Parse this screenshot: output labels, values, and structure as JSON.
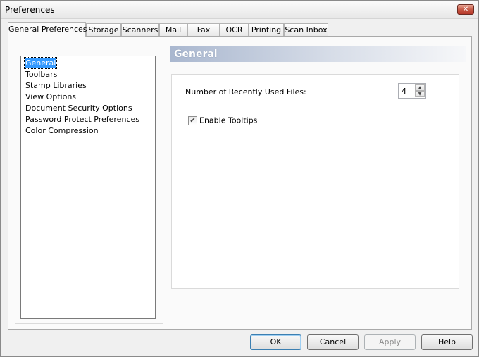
{
  "window": {
    "title": "Preferences",
    "close_glyph": "✕"
  },
  "tabs": [
    {
      "label": "General Preferences",
      "active": true
    },
    {
      "label": "Storage"
    },
    {
      "label": "Scanners"
    },
    {
      "label": "Mail"
    },
    {
      "label": "Fax"
    },
    {
      "label": "OCR"
    },
    {
      "label": "Printing"
    },
    {
      "label": "Scan Inbox"
    }
  ],
  "nav": {
    "items": [
      {
        "label": "General",
        "selected": true
      },
      {
        "label": "Toolbars"
      },
      {
        "label": "Stamp Libraries"
      },
      {
        "label": "View Options"
      },
      {
        "label": "Document Security Options"
      },
      {
        "label": "Password Protect Preferences"
      },
      {
        "label": "Color Compression"
      }
    ]
  },
  "section": {
    "title": "General",
    "recent_files_label": "Number of Recently Used Files:",
    "recent_files_value": "4",
    "tooltips_label": "Enable Tooltips",
    "tooltips_checked": true
  },
  "buttons": {
    "ok": "OK",
    "cancel": "Cancel",
    "apply": "Apply",
    "help": "Help"
  },
  "icons": {
    "close": "close-icon",
    "spin_up": "arrow-up-icon",
    "spin_down": "arrow-down-icon",
    "check": "checkmark-icon"
  }
}
